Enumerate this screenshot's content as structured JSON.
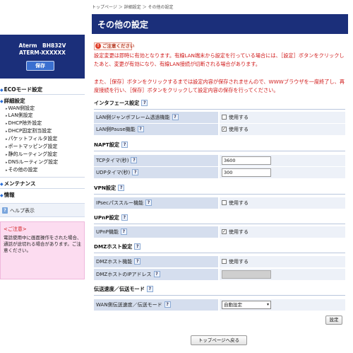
{
  "sidebar": {
    "device_model": "Aterm　BH832V",
    "device_serial": "ATERM-XXXXXX",
    "save_label": "保存",
    "nav": [
      {
        "label": "ECOモード設定"
      },
      {
        "label": "詳細設定"
      },
      {
        "label": "メンテナンス"
      },
      {
        "label": "情報"
      }
    ],
    "sub_items": [
      {
        "label": "WAN側設定"
      },
      {
        "label": "LAN側設定"
      },
      {
        "label": "DHCP除外設定"
      },
      {
        "label": "DHCP固定割当設定"
      },
      {
        "label": "パケットフィルタ設定"
      },
      {
        "label": "ポートマッピング設定"
      },
      {
        "label": "静的ルーティング設定"
      },
      {
        "label": "DNSルーティング設定"
      },
      {
        "label": "その他の設定"
      }
    ],
    "help_icon": "?",
    "help_label": "ヘルプ表示",
    "caution_title": "<ご注意>",
    "caution_text": "電話使用中に画面操作をされた場合、通話が途切れる場合があります。ご注意ください。"
  },
  "breadcrumb": "トップページ ＞ 詳細設定 ＞ その他の設定",
  "page_title": "その他の設定",
  "notice": {
    "badge": "ご注意ください",
    "text1": "設定変更は即時に有効となります。有線LAN端末から設定を行っている場合には、［設定］ボタンをクリックしたあと、変更が有効になり、有線LAN接続が切断される場合があります。",
    "text2": "また、［保存］ボタンをクリックするまでは設定内容が保存されませんので、WWWブラウザを一度終了し、再度接続を行い、［保存］ボタンをクリックして設定内容の保存を行ってください。"
  },
  "help_mark": "?",
  "sections": [
    {
      "title": "インタフェース設定",
      "rows": [
        {
          "label": "LAN側ジャンボフレーム透過機能",
          "control": "checkbox",
          "checked": false,
          "value": "使用する"
        },
        {
          "label": "LAN側Pause機能",
          "control": "checkbox",
          "checked": true,
          "value": "使用する"
        }
      ]
    },
    {
      "title": "NAPT設定",
      "rows": [
        {
          "label": "TCPタイマ(秒)",
          "control": "text",
          "value": "3600"
        },
        {
          "label": "UDPタイマ(秒)",
          "control": "text",
          "value": "300"
        }
      ]
    },
    {
      "title": "VPN設定",
      "rows": [
        {
          "label": "IPsecパススルー機能",
          "control": "checkbox",
          "checked": false,
          "value": "使用する"
        }
      ]
    },
    {
      "title": "UPnP設定",
      "rows": [
        {
          "label": "UPnP機能",
          "control": "checkbox",
          "checked": true,
          "value": "使用する"
        }
      ]
    },
    {
      "title": "DMZホスト設定",
      "rows": [
        {
          "label": "DMZホスト機能",
          "control": "checkbox",
          "checked": false,
          "value": "使用する"
        },
        {
          "label": "DMZホストのIPアドレス",
          "control": "text-disabled",
          "value": ""
        }
      ]
    },
    {
      "title": "伝送速度／伝送モード",
      "rows": [
        {
          "label": "WAN側伝送速度／伝送モード",
          "control": "select",
          "value": "自動設定"
        }
      ]
    }
  ],
  "settings_button": "設定",
  "back_to_top_button": "トップページへ戻る",
  "check_mark": "✓",
  "select_arrow": "▾"
}
